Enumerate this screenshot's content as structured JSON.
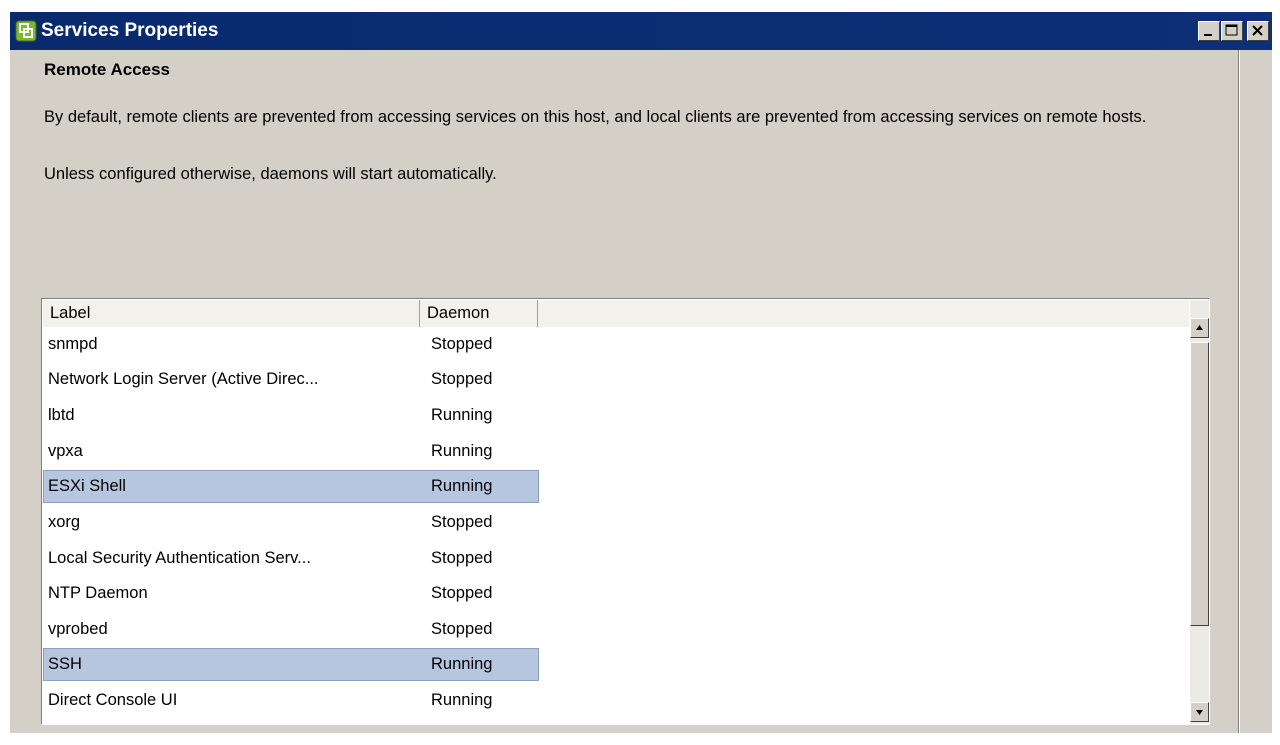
{
  "window": {
    "title": "Services Properties",
    "icon": "vsphere-app-icon",
    "controls": [
      "minimize-icon",
      "maximize-icon",
      "close-icon"
    ]
  },
  "section": {
    "heading": "Remote Access",
    "paragraph1": "By default, remote clients are prevented from accessing services on this host, and local clients are prevented from accessing services on remote hosts.",
    "paragraph2": "Unless configured otherwise, daemons will start automatically."
  },
  "table": {
    "columns": [
      "Label",
      "Daemon"
    ],
    "rows": [
      {
        "label": "snmpd",
        "daemon": "Stopped",
        "selected": false
      },
      {
        "label": "Network Login Server (Active Direc...",
        "daemon": "Stopped",
        "selected": false
      },
      {
        "label": "lbtd",
        "daemon": "Running",
        "selected": false
      },
      {
        "label": "vpxa",
        "daemon": "Running",
        "selected": false
      },
      {
        "label": "ESXi Shell",
        "daemon": "Running",
        "selected": true
      },
      {
        "label": "xorg",
        "daemon": "Stopped",
        "selected": false
      },
      {
        "label": "Local Security Authentication Serv...",
        "daemon": "Stopped",
        "selected": false
      },
      {
        "label": "NTP Daemon",
        "daemon": "Stopped",
        "selected": false
      },
      {
        "label": "vprobed",
        "daemon": "Stopped",
        "selected": false
      },
      {
        "label": "SSH",
        "daemon": "Running",
        "selected": true
      },
      {
        "label": "Direct Console UI",
        "daemon": "Running",
        "selected": false
      }
    ]
  },
  "colors": {
    "titlebar": "#0a2a6e",
    "dialog_bg": "#d4d0c8",
    "selection": "#b6c6de"
  }
}
